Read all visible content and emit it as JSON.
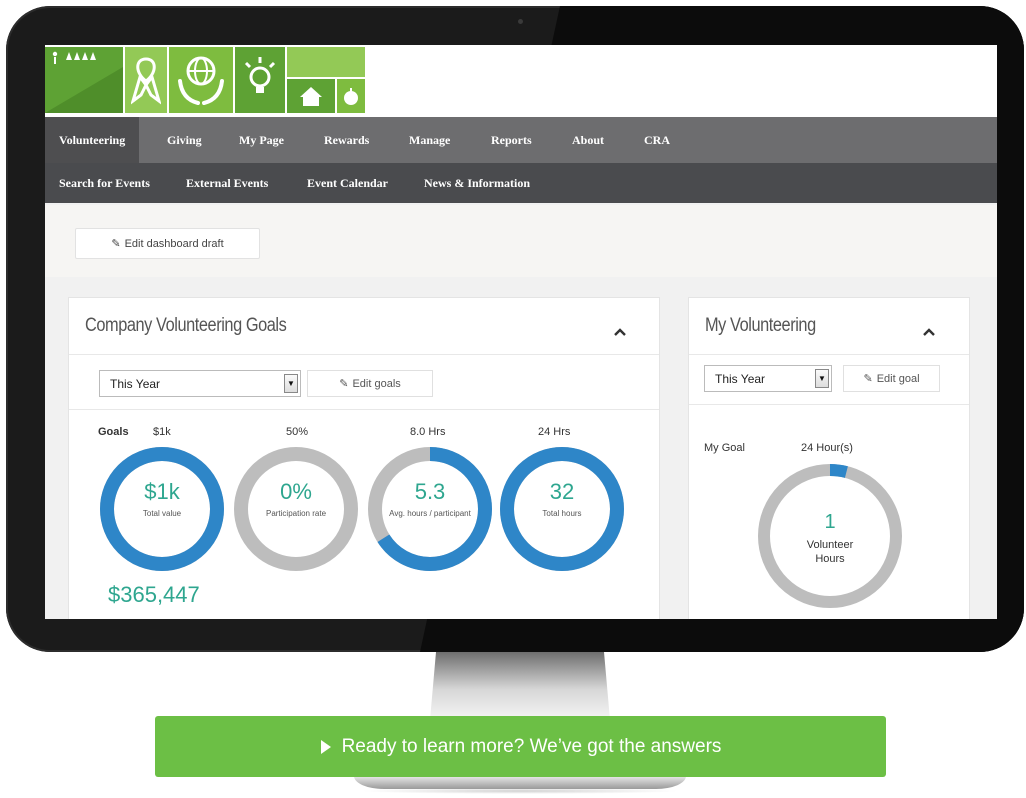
{
  "nav": {
    "primary": [
      "Volunteering",
      "Giving",
      "My Page",
      "Rewards",
      "Manage",
      "Reports",
      "About",
      "CRA"
    ],
    "secondary": [
      "Search for Events",
      "External Events",
      "Event Calendar",
      "News & Information"
    ]
  },
  "dashboard": {
    "edit_draft_label": "Edit dashboard draft"
  },
  "company_goals": {
    "title": "Company Volunteering Goals",
    "period_select": "This Year",
    "edit_goals_label": "Edit goals",
    "goals_heading": "Goals",
    "rings": [
      {
        "goal": "$1k",
        "value": "$1k",
        "label": "Total value",
        "fraction": 1.0
      },
      {
        "goal": "50%",
        "value": "0%",
        "label": "Participation rate",
        "fraction": 0.0
      },
      {
        "goal": "8.0 Hrs",
        "value": "5.3",
        "label": "Avg. hours / participant",
        "fraction": 0.66
      },
      {
        "goal": "24 Hrs",
        "value": "32",
        "label": "Total hours",
        "fraction": 1.0
      }
    ],
    "total_amount": "$365,447"
  },
  "my_volunteering": {
    "title": "My Volunteering",
    "period_select": "This Year",
    "edit_goal_label": "Edit goal",
    "my_goal_label": "My Goal",
    "my_goal_value": "24 Hour(s)",
    "hours_value": "1",
    "hours_label_line1": "Volunteer",
    "hours_label_line2": "Hours",
    "fraction": 0.04
  },
  "cta": {
    "label": "Ready to learn more? We’ve got the answers"
  },
  "colors": {
    "ring_blue": "#2e86c8",
    "ring_gray": "#bdbdbd",
    "value_teal": "#2ea68f",
    "cta_green": "#6cbf45"
  }
}
